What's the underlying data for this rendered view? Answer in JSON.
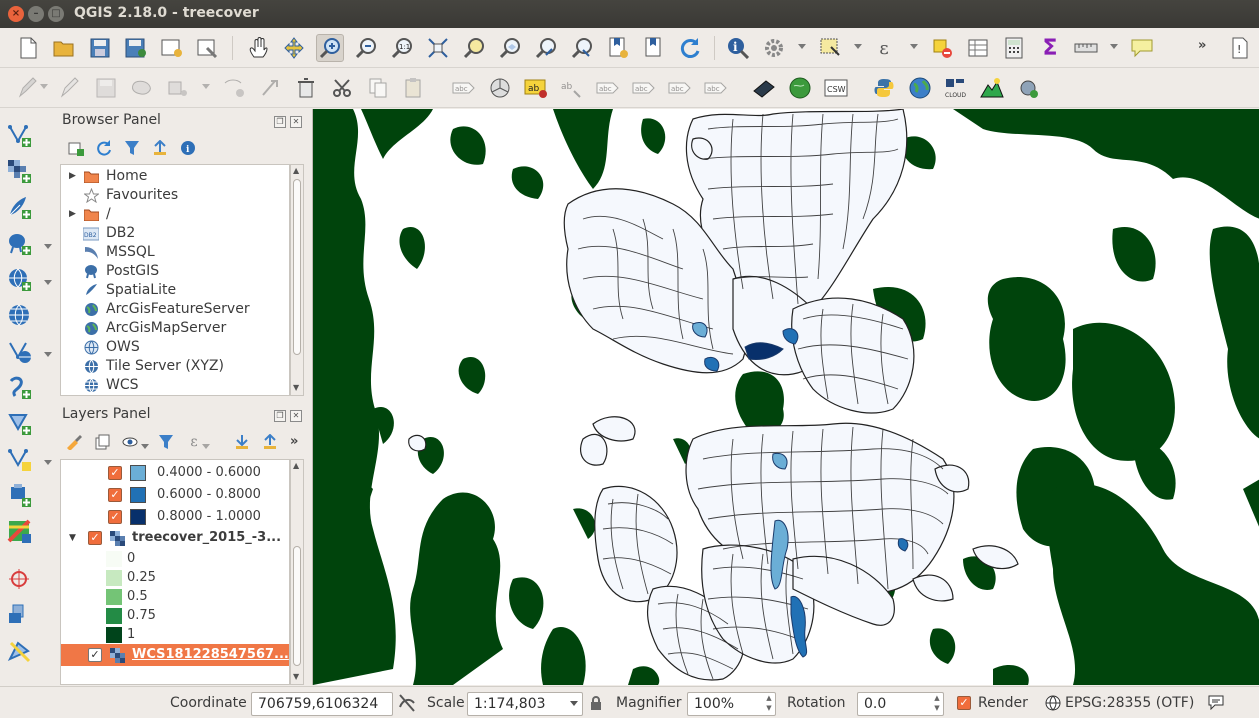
{
  "window": {
    "title": "QGIS 2.18.0 - treecover"
  },
  "toolbar_top": {
    "icons": [
      "new-project-icon",
      "open-project-icon",
      "save-project-icon",
      "save-as-icon",
      "new-print-composer-icon",
      "composer-manager-icon",
      "pan-icon",
      "pan-to-selection-icon",
      "zoom-in-icon",
      "zoom-out-icon",
      "zoom-native-icon",
      "zoom-full-icon",
      "zoom-to-selection-icon",
      "zoom-to-layer-icon",
      "zoom-last-icon",
      "zoom-next-icon",
      "new-bookmark-icon",
      "show-bookmarks-icon",
      "refresh-icon",
      "identify-icon",
      "run-action-icon",
      "select-features-icon",
      "select-by-expression-icon",
      "deselect-icon",
      "attribute-table-icon",
      "field-calculator-icon",
      "statistics-icon",
      "measure-icon",
      "annotation-icon"
    ],
    "overflow": "»"
  },
  "toolbar_second": {
    "icons": [
      "current-edits-icon",
      "toggle-editing-icon",
      "save-edits-icon",
      "add-feature-icon",
      "move-feature-icon",
      "node-tool-icon",
      "add-part-icon",
      "delete-selected-icon",
      "cut-features-icon",
      "copy-features-icon",
      "paste-features-icon",
      "label-icon",
      "diagram-icon",
      "label-highlight-icon",
      "pin-labels-icon",
      "show-labels-icon",
      "move-label-icon",
      "rotate-label-icon",
      "change-label-icon",
      "metasearch-icon",
      "geo-search-icon",
      "csw-icon",
      "python-console-icon",
      "globe-icon",
      "qgis-cloud-icon",
      "profile-tool-icon",
      "plugin-icon"
    ]
  },
  "browser_panel": {
    "title": "Browser Panel",
    "items": [
      {
        "label": "Home",
        "icon": "folder-icon",
        "expandable": true
      },
      {
        "label": "Favourites",
        "icon": "star-icon",
        "expandable": false
      },
      {
        "label": "/",
        "icon": "folder-icon",
        "expandable": true
      },
      {
        "label": "DB2",
        "icon": "db2-icon",
        "expandable": false
      },
      {
        "label": "MSSQL",
        "icon": "mssql-icon",
        "expandable": false
      },
      {
        "label": "PostGIS",
        "icon": "postgis-icon",
        "expandable": false
      },
      {
        "label": "SpatiaLite",
        "icon": "spatialite-icon",
        "expandable": false
      },
      {
        "label": "ArcGisFeatureServer",
        "icon": "globe-icon",
        "expandable": false
      },
      {
        "label": "ArcGisMapServer",
        "icon": "globe-icon",
        "expandable": false
      },
      {
        "label": "OWS",
        "icon": "globe-icon",
        "expandable": false
      },
      {
        "label": "Tile Server (XYZ)",
        "icon": "globe-icon",
        "expandable": false
      },
      {
        "label": "WCS",
        "icon": "globe-icon",
        "expandable": false
      }
    ]
  },
  "layers_panel": {
    "title": "Layers Panel",
    "overflow": "»",
    "classes": [
      {
        "label": "0.4000 - 0.6000",
        "color": "#6baed6"
      },
      {
        "label": "0.6000 - 0.8000",
        "color": "#2171b5"
      },
      {
        "label": "0.8000 - 1.0000",
        "color": "#08306b"
      }
    ],
    "raster_layer": {
      "name": "treecover_2015_-3...",
      "legend": [
        {
          "label": "0",
          "color": "#f7fcf5"
        },
        {
          "label": "0.25",
          "color": "#c7e9c0"
        },
        {
          "label": "0.5",
          "color": "#74c476"
        },
        {
          "label": "0.75",
          "color": "#238b45"
        },
        {
          "label": "1",
          "color": "#00441b"
        }
      ]
    },
    "selected_layer": {
      "name": "WCS181228547567..."
    }
  },
  "map_colors": {
    "forest": "#00440c",
    "suburb_fill": "#f5f8fd",
    "suburb_line": "#222222",
    "water": "#2a6fb8"
  },
  "statusbar": {
    "coordinate_label": "Coordinate",
    "coordinate_value": "706759,6106324",
    "scale_label": "Scale",
    "scale_value": "1:174,803",
    "magnifier_label": "Magnifier",
    "magnifier_value": "100%",
    "rotation_label": "Rotation",
    "rotation_value": "0.0",
    "render_label": "Render",
    "crs_label": "EPSG:28355 (OTF)"
  }
}
